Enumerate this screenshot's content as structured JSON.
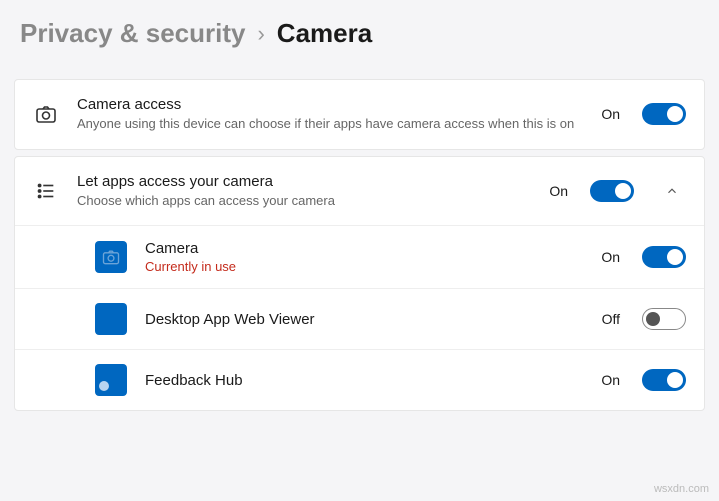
{
  "breadcrumb": {
    "parent": "Privacy & security",
    "current": "Camera"
  },
  "sections": {
    "access": {
      "title": "Camera access",
      "subtitle": "Anyone using this device can choose if their apps have camera access when this is on",
      "state": "On"
    },
    "apps": {
      "title": "Let apps access your camera",
      "subtitle": "Choose which apps can access your camera",
      "state": "On"
    }
  },
  "app_list": [
    {
      "name": "Camera",
      "status": "Currently in use",
      "state": "On"
    },
    {
      "name": "Desktop App Web Viewer",
      "state": "Off"
    },
    {
      "name": "Feedback Hub",
      "state": "On"
    }
  ],
  "watermark": "wsxdn.com"
}
